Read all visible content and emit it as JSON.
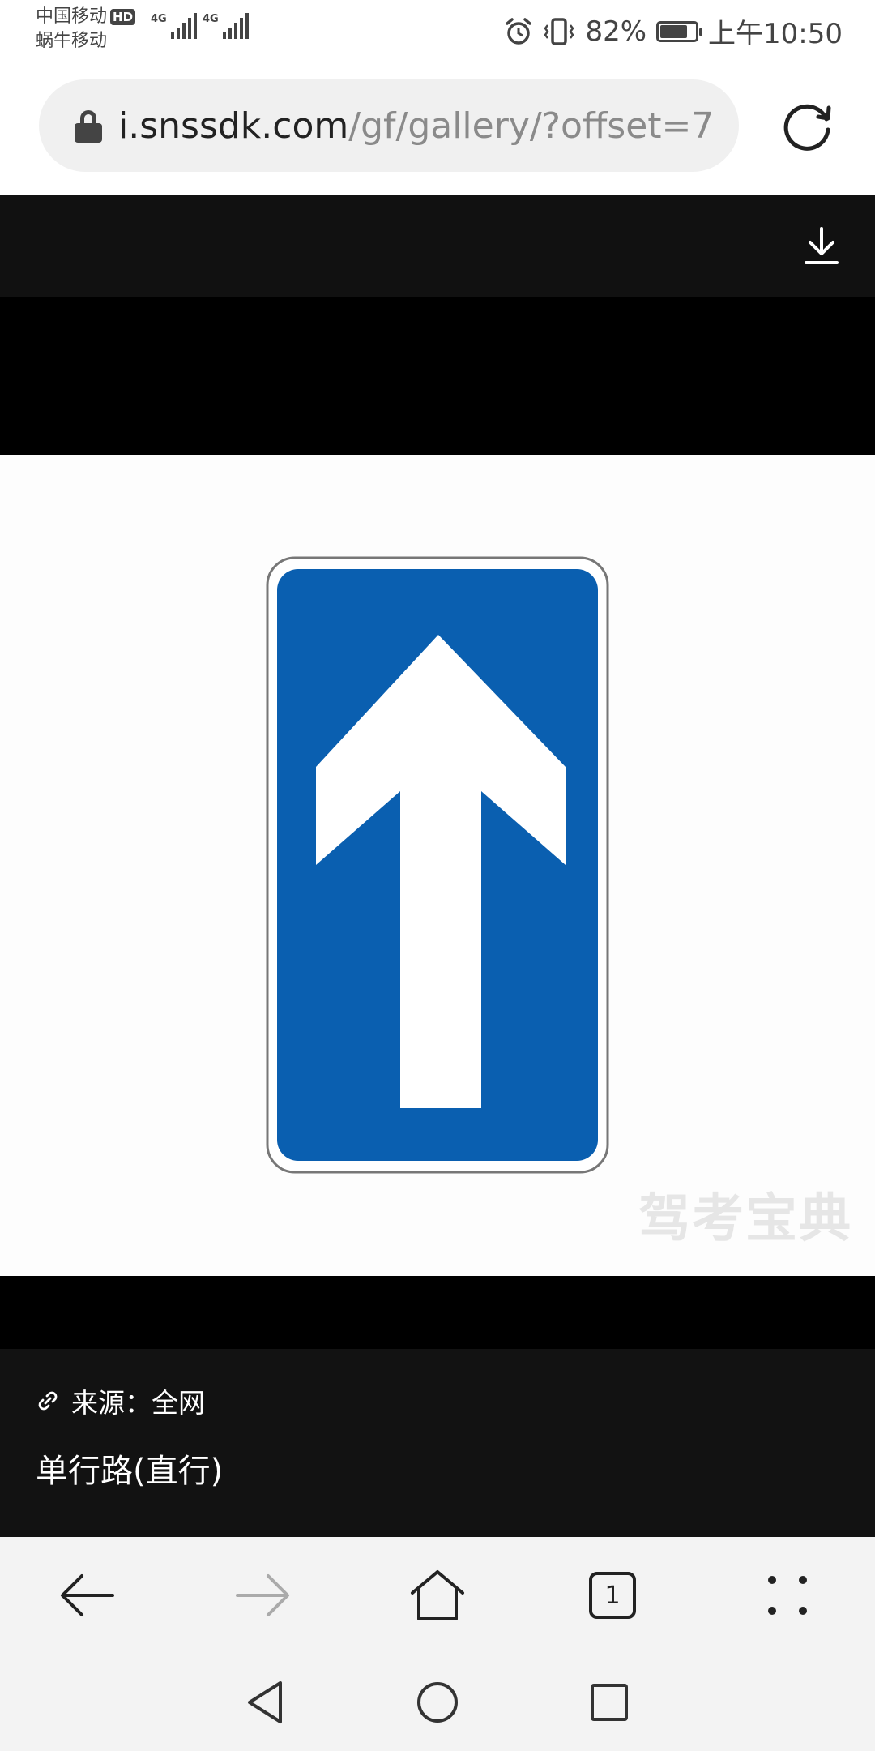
{
  "status_bar": {
    "carrier1": "中国移动",
    "hd_badge": "HD",
    "carrier2": "蜗牛移动",
    "signal1_label": "4G",
    "signal2_label": "4G",
    "battery_percent": "82%",
    "battery_level": 0.82,
    "time": "上午10:50"
  },
  "url_bar": {
    "host": "i.snssdk.com",
    "path": "/gf/gallery/?offset=7"
  },
  "gallery": {
    "watermark": "驾考宝典",
    "sign_color": "#0a5fb0"
  },
  "caption": {
    "source_label": "来源：全网",
    "title": "单行路(直行)"
  },
  "browser_nav": {
    "tab_count": "1"
  }
}
